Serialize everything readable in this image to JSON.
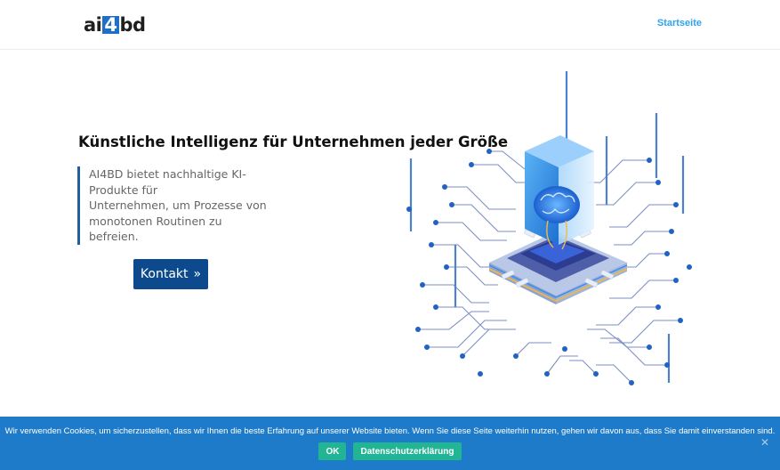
{
  "header": {
    "logo": {
      "prefix": "ai",
      "highlight": "4",
      "suffix": "bd"
    },
    "nav": {
      "home_label": "Startseite"
    }
  },
  "hero": {
    "title": "Künstliche Intelligenz für Unternehmen jeder Größe",
    "quote_lines": [
      "AI4BD bietet nachhaltige KI-",
      "Produkte für",
      "Unternehmen, um Prozesse von",
      "monotonen Routinen zu",
      "befreien."
    ],
    "contact_label": "Kontakt",
    "contact_icon": "double-chevron-right-icon"
  },
  "illustration": {
    "icon": "ai-chip-brain-illustration"
  },
  "cookie": {
    "text": "Wir verwenden Cookies, um sicherzustellen, dass wir Ihnen die beste Erfahrung auf unserer Website bieten. Wenn Sie diese Seite weiterhin nutzen, gehen wir davon aus, dass Sie damit einverstanden sind.",
    "ok_label": "OK",
    "privacy_label": "Datenschutzerklärung",
    "close_icon": "close-icon"
  },
  "colors": {
    "brand_blue": "#0d4a8d",
    "link_blue": "#2ea3f2",
    "cookie_bg": "#1e7bc9",
    "cookie_button": "#21b594"
  }
}
